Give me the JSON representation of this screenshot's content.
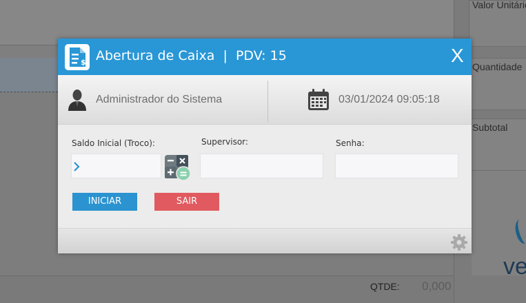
{
  "background": {
    "right_fields": [
      "Valor Unitário",
      "Quantidade",
      "Subtotal"
    ],
    "logo_text": "ve",
    "qtde_label": "QTDE:",
    "qtde_value": "0,000"
  },
  "modal": {
    "title": "Abertura de Caixa  |  PDV: 15",
    "close_label": "X",
    "user_name": "Administrador do Sistema",
    "datetime": "03/01/2024 09:05:18",
    "fields": {
      "saldo_label": "Saldo Inicial (Troco):",
      "saldo_value": "",
      "supervisor_label": "Supervisor:",
      "supervisor_value": "",
      "senha_label": "Senha:",
      "senha_value": ""
    },
    "buttons": {
      "iniciar": "INICIAR",
      "sair": "SAIR"
    }
  },
  "colors": {
    "header": "#2997d6",
    "primary_button": "#2a93d0",
    "danger_button": "#e05a5f",
    "overlay": "#7f7f7f"
  },
  "icons": [
    "receipt-dollar-icon",
    "user-icon",
    "calendar-icon",
    "calculator-icon",
    "gear-icon",
    "chevron-right-icon"
  ]
}
